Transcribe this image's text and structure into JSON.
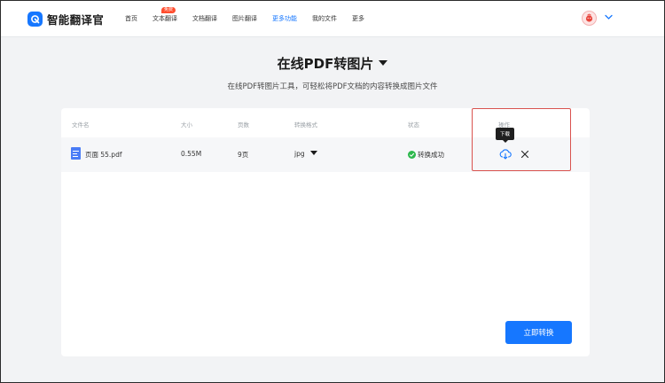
{
  "app": {
    "name": "智能翻译官"
  },
  "nav": {
    "items": [
      {
        "label": "首页"
      },
      {
        "label": "文本翻译",
        "badge": "免费"
      },
      {
        "label": "文档翻译"
      },
      {
        "label": "图片翻译"
      },
      {
        "label": "更多功能",
        "active": true
      },
      {
        "label": "我的文件"
      },
      {
        "label": "更多"
      }
    ]
  },
  "page": {
    "title": "在线PDF转图片",
    "subtitle": "在线PDF转图片工具，可轻松将PDF文档的内容转换成图片文件"
  },
  "table": {
    "headers": {
      "filename": "文件名",
      "size": "大小",
      "pages": "页数",
      "format": "转换格式",
      "status": "状态",
      "actions": "操作"
    },
    "rows": [
      {
        "filename": "页面 55.pdf",
        "size": "0.55M",
        "pages": "9页",
        "format": "jpg",
        "status": "转换成功"
      }
    ]
  },
  "tooltip": {
    "download": "下载"
  },
  "buttons": {
    "convert": "立即转换"
  },
  "colors": {
    "accent": "#1677ff",
    "success": "#2db84d",
    "highlight": "#d9534f",
    "badge": "#ff4d2e"
  }
}
